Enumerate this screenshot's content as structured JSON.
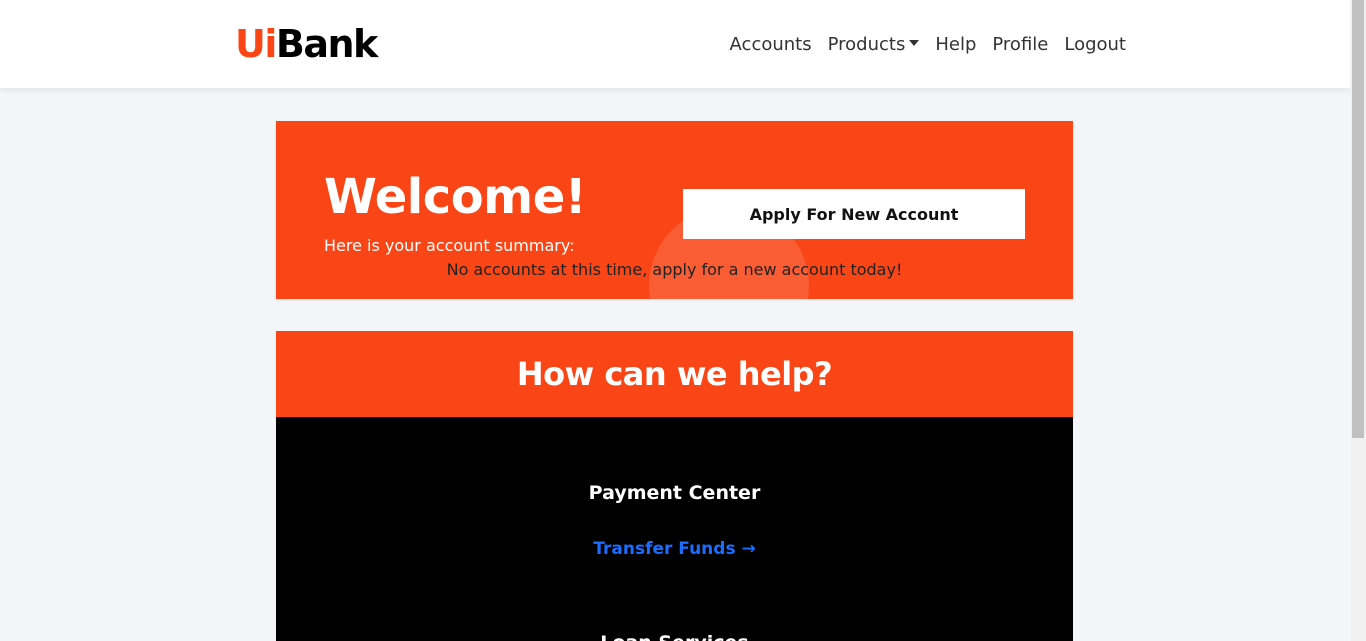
{
  "brand": {
    "prefix": "Ui",
    "name": "Bank"
  },
  "nav": {
    "accounts": "Accounts",
    "products": "Products",
    "help": "Help",
    "profile": "Profile",
    "logout": "Logout"
  },
  "welcome": {
    "title": "Welcome!",
    "summary": "Here is your account summary:",
    "empty": "No accounts at this time, apply for a new account today!",
    "apply_button": "Apply For New Account"
  },
  "help": {
    "title": "How can we help?",
    "payment_center": "Payment Center",
    "transfer_link": "Transfer Funds →",
    "next_section": "Loan Services"
  },
  "colors": {
    "brand_orange": "#fa4616",
    "link_blue": "#1a6dff",
    "page_bg": "#f4f5f9"
  }
}
